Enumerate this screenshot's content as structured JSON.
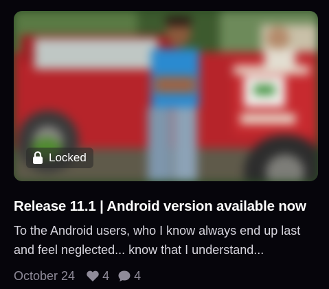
{
  "post": {
    "lock_label": "Locked",
    "title": "Release 11.1 | Android version available now",
    "description": "To the Android users, who I know always end up last and feel neglected... know that I understand...",
    "date": "October 24",
    "likes": "4",
    "comments": "4"
  },
  "icons": {
    "lock": "lock-icon",
    "like": "heart-icon",
    "comment": "comment-icon"
  },
  "colors": {
    "background": "#06050b",
    "title": "#ffffff",
    "description": "#d7d5de",
    "meta": "#8f8b99"
  }
}
